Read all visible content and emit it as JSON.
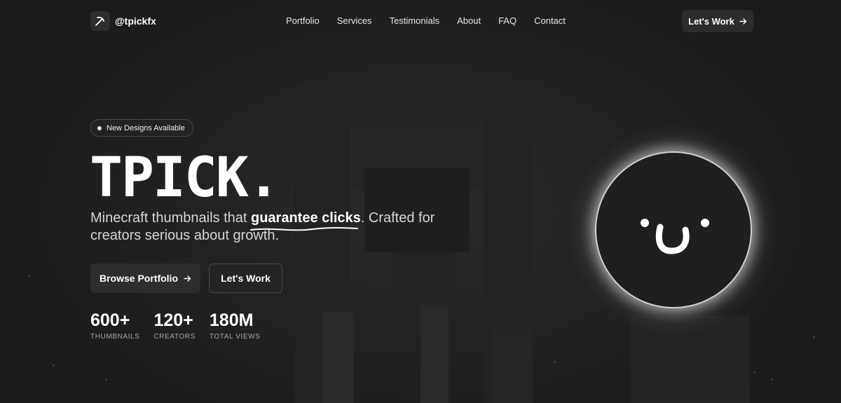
{
  "brand": {
    "handle": "@tpickfx",
    "icon": "pickaxe-icon"
  },
  "nav": {
    "items": [
      "Portfolio",
      "Services",
      "Testimonials",
      "About",
      "FAQ",
      "Contact"
    ],
    "cta_label": "Let's Work"
  },
  "hero": {
    "badge": "New Designs Available",
    "title": "TPICK.",
    "tagline_before": "Minecraft thumbnails that ",
    "tagline_highlight": "guarantee clicks",
    "tagline_after": ". Crafted for creators serious about growth.",
    "primary_button": "Browse Portfolio",
    "secondary_button": "Let's Work"
  },
  "stats": [
    {
      "value": "600+",
      "label": "THUMBNAILS"
    },
    {
      "value": "120+",
      "label": "CREATORS"
    },
    {
      "value": "180M",
      "label": "TOTAL VIEWS"
    }
  ],
  "colors": {
    "background": "#1c1c1c",
    "accent": "#ffffff",
    "button": "#2d2d2d"
  }
}
